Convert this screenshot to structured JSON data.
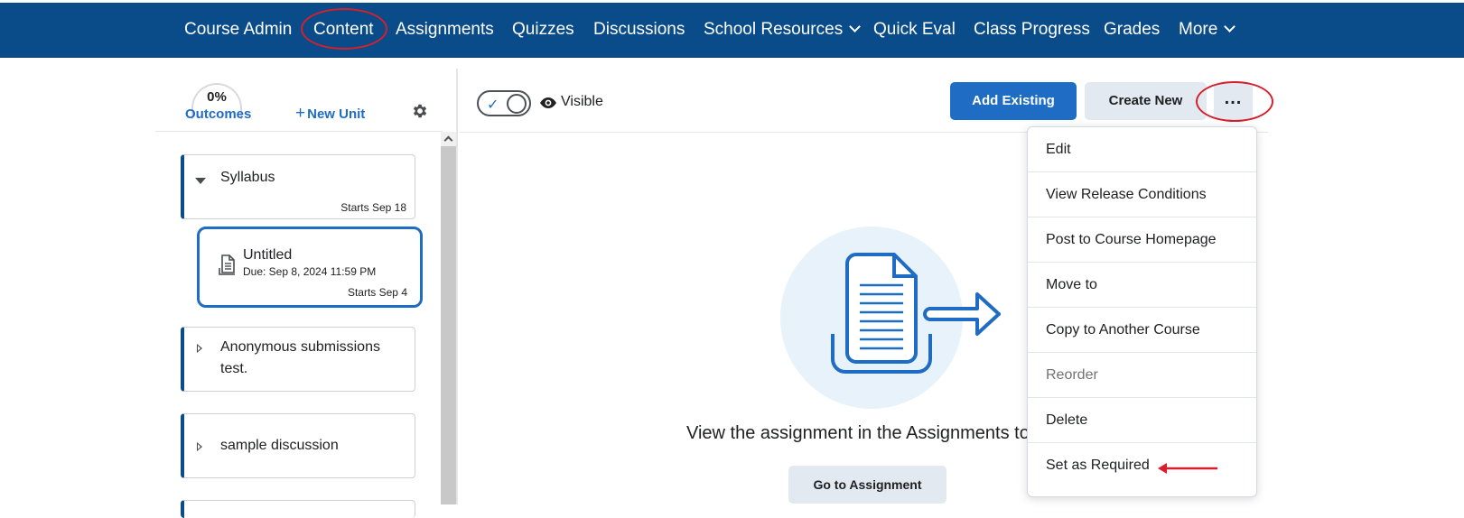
{
  "nav": {
    "items": [
      {
        "label": "Course Admin",
        "has_dropdown": false
      },
      {
        "label": "Content",
        "has_dropdown": false
      },
      {
        "label": "Assignments",
        "has_dropdown": false
      },
      {
        "label": "Quizzes",
        "has_dropdown": false
      },
      {
        "label": "Discussions",
        "has_dropdown": false
      },
      {
        "label": "School Resources",
        "has_dropdown": true
      },
      {
        "label": "Quick Eval",
        "has_dropdown": false
      },
      {
        "label": "Class Progress",
        "has_dropdown": false
      },
      {
        "label": "Grades",
        "has_dropdown": false
      },
      {
        "label": "More",
        "has_dropdown": true
      }
    ],
    "highlighted": "Content",
    "bg_color": "#0a4c8a"
  },
  "sidebar": {
    "outcomes_percent": "0%",
    "outcomes_label": "Outcomes",
    "new_unit_label": "New Unit",
    "settings_icon": "gear-icon",
    "units": [
      {
        "title": "Syllabus",
        "starts": "Starts Sep 18",
        "expanded": true
      },
      {
        "title": "Anonymous submissions test.",
        "starts": "",
        "expanded": false
      },
      {
        "title": "sample discussion",
        "starts": "",
        "expanded": false
      }
    ],
    "topic": {
      "title": "Untitled",
      "due": "Due: Sep 8, 2024 11:59 PM",
      "starts": "Starts Sep 4",
      "icon": "document-icon"
    }
  },
  "toolbar": {
    "visibility_label": "Visible",
    "visibility_on": true,
    "add_existing_label": "Add Existing",
    "create_new_label": "Create New",
    "more_label": "..."
  },
  "main": {
    "empty_message": "View the assignment in the Assignments to",
    "go_to_label": "Go to Assignment",
    "illustration": "assignment-document-arrow-icon"
  },
  "dropdown": {
    "items": [
      {
        "label": "Edit",
        "enabled": true
      },
      {
        "label": "View Release Conditions",
        "enabled": true
      },
      {
        "label": "Post to Course Homepage",
        "enabled": true
      },
      {
        "label": "Move to",
        "enabled": true
      },
      {
        "label": "Copy to Another Course",
        "enabled": true
      },
      {
        "label": "Reorder",
        "enabled": false
      },
      {
        "label": "Delete",
        "enabled": true
      },
      {
        "label": "Set as Required",
        "enabled": true
      }
    ],
    "annotated_item": "Set as Required"
  },
  "colors": {
    "accent": "#1f6cc4",
    "annotation": "#d71f2b",
    "illustration_bg": "#e7f2fb"
  }
}
